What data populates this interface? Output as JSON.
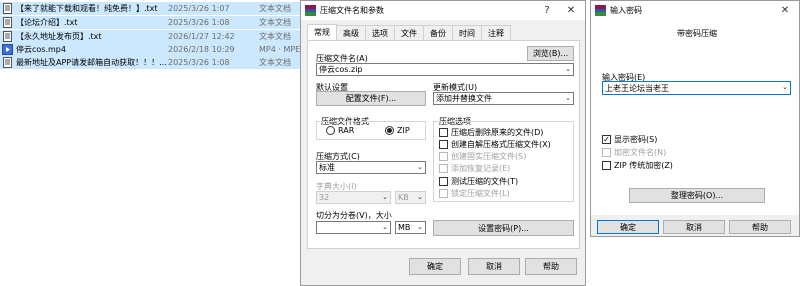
{
  "file_list": [
    {
      "name": "【来了就能下载和观看！纯免费！】.txt",
      "date": "2025/3/26 1:07",
      "type": "文本文档",
      "icon": "text-file-icon"
    },
    {
      "name": "【论坛介绍】.txt",
      "date": "2025/3/26 1:08",
      "type": "文本文档",
      "icon": "text-file-icon"
    },
    {
      "name": "【永久地址发布页】.txt",
      "date": "2026/1/27 12:42",
      "type": "文本文档",
      "icon": "text-file-icon"
    },
    {
      "name": "停云cos.mp4",
      "date": "2026/2/18 10:29",
      "type": "MP4 · MPE",
      "icon": "video-file-icon"
    },
    {
      "name": "最新地址及APP请发邮箱自动获取！！！...",
      "date": "2025/3/26 1:08",
      "type": "文本文档",
      "icon": "text-file-icon"
    }
  ],
  "archive_dialog": {
    "title": "压缩文件名和参数",
    "help_btn": "?",
    "close_btn": "✕",
    "tabs": [
      "常规",
      "高级",
      "选项",
      "文件",
      "备份",
      "时间",
      "注释"
    ],
    "active_tab": "常规",
    "archive_name_label": "压缩文件名(A)",
    "browse_btn": "浏览(B)...",
    "archive_name_value": "停云cos.zip",
    "default_profile_label": "默认设置",
    "profiles_btn": "配置文件(F)...",
    "update_mode_label": "更新模式(U)",
    "update_mode_value": "添加并替换文件",
    "format_label": "压缩文件格式",
    "format_options": [
      "RAR",
      "ZIP"
    ],
    "format_selected": "ZIP",
    "options_label": "压缩选项",
    "options": [
      {
        "label": "压缩后删除原来的文件(D)",
        "checked": false,
        "enabled": true
      },
      {
        "label": "创建自解压格式压缩文件(X)",
        "checked": false,
        "enabled": true
      },
      {
        "label": "创建固实压缩文件(S)",
        "checked": false,
        "enabled": false
      },
      {
        "label": "添加恢复记录(E)",
        "checked": false,
        "enabled": false
      },
      {
        "label": "测试压缩的文件(T)",
        "checked": false,
        "enabled": true
      },
      {
        "label": "锁定压缩文件(L)",
        "checked": false,
        "enabled": false
      }
    ],
    "method_label": "压缩方式(C)",
    "method_value": "标准",
    "dict_label": "字典大小(I)",
    "dict_value": "32",
    "dict_unit": "KB",
    "split_label": "切分为分卷(V)，大小",
    "split_value": "",
    "split_unit": "MB",
    "set_password_btn": "设置密码(P)...",
    "ok_btn": "确定",
    "cancel_btn": "取消",
    "help_bottom_btn": "帮助"
  },
  "password_dialog": {
    "title": "输入密码",
    "close_btn": "✕",
    "heading": "带密码压缩",
    "enter_label": "输入密码(E)",
    "password_value": "上老王论坛当老王",
    "show_password": {
      "label": "显示密码(S)",
      "checked": true,
      "enabled": true
    },
    "encrypt_names": {
      "label": "加密文件名(N)",
      "checked": false,
      "enabled": false
    },
    "zip_legacy": {
      "label": "ZIP 传统加密(Z)",
      "checked": false,
      "enabled": true
    },
    "organize_btn": "整理密码(O)...",
    "ok_btn": "确定",
    "cancel_btn": "取消",
    "help_btn": "帮助"
  },
  "colors": {
    "selection": "#cce8ff",
    "accent": "#0078d7",
    "dialog_bg": "#f0f0f0"
  }
}
